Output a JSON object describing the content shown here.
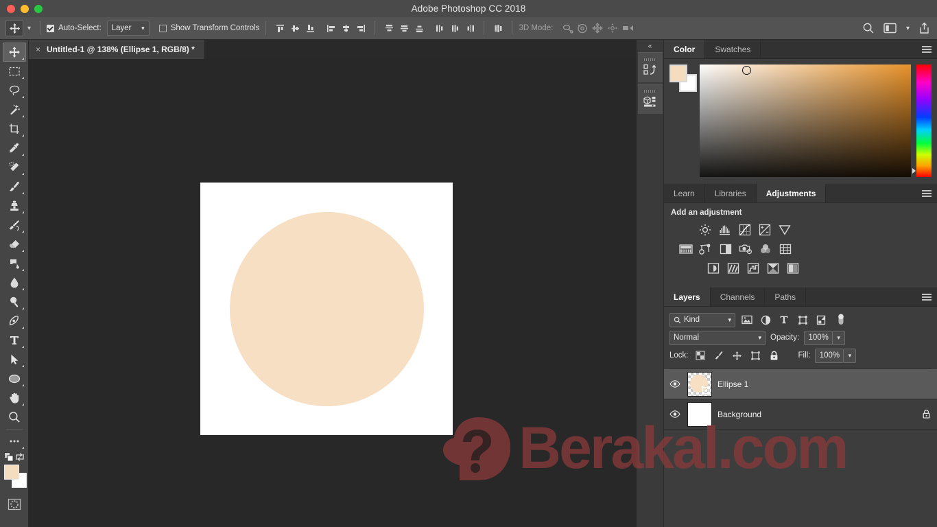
{
  "window": {
    "title": "Adobe Photoshop CC 2018",
    "traffic_lights": [
      {
        "name": "close",
        "color": "#ff5f57"
      },
      {
        "name": "minimize",
        "color": "#febc2e"
      },
      {
        "name": "maximize",
        "color": "#28c840"
      }
    ]
  },
  "options_bar": {
    "tool_icon": "move-tool-icon",
    "auto_select_checked": true,
    "auto_select_label": "Auto-Select:",
    "auto_select_value": "Layer",
    "show_transform_checked": false,
    "show_transform_label": "Show Transform Controls",
    "align_group_1": [
      "align-top-edges-icon",
      "align-vertical-centers-icon",
      "align-bottom-edges-icon"
    ],
    "align_group_2": [
      "align-left-edges-icon",
      "align-horizontal-centers-icon",
      "align-right-edges-icon"
    ],
    "distribute_group_1": [
      "distribute-top-edges-icon",
      "distribute-vertical-centers-icon",
      "distribute-bottom-edges-icon"
    ],
    "distribute_group_2": [
      "distribute-left-edges-icon",
      "distribute-horizontal-centers-icon",
      "distribute-right-edges-icon"
    ],
    "auto_align_icon": "auto-align-layers-icon",
    "mode_3d_label": "3D Mode:",
    "mode_3d_icons": [
      "rotate-3d-object-icon",
      "roll-3d-object-icon",
      "drag-3d-object-icon",
      "slide-3d-object-icon",
      "scale-3d-object-icon"
    ],
    "right_icons": [
      "search-icon",
      "workspace-switcher-icon",
      "chevron-down-icon",
      "share-icon"
    ]
  },
  "document_tab": {
    "close_glyph": "×",
    "title": "Untitled-1 @ 138% (Ellipse 1, RGB/8) *"
  },
  "toolbar": {
    "tools": [
      {
        "name": "move-tool",
        "active": true
      },
      {
        "name": "rectangular-marquee-tool",
        "active": false
      },
      {
        "name": "lasso-tool",
        "active": false
      },
      {
        "name": "magic-wand-tool",
        "active": false
      },
      {
        "name": "crop-tool",
        "active": false
      },
      {
        "name": "eyedropper-tool",
        "active": false
      },
      {
        "name": "spot-healing-brush-tool",
        "active": false
      },
      {
        "name": "brush-tool",
        "active": false
      },
      {
        "name": "clone-stamp-tool",
        "active": false
      },
      {
        "name": "history-brush-tool",
        "active": false
      },
      {
        "name": "eraser-tool",
        "active": false
      },
      {
        "name": "gradient-tool",
        "active": false
      },
      {
        "name": "blur-tool",
        "active": false
      },
      {
        "name": "dodge-tool",
        "active": false
      },
      {
        "name": "pen-tool",
        "active": false
      },
      {
        "name": "horizontal-type-tool",
        "active": false
      },
      {
        "name": "path-selection-tool",
        "active": false
      },
      {
        "name": "ellipse-tool",
        "active": false
      },
      {
        "name": "hand-tool",
        "active": false
      },
      {
        "name": "zoom-tool",
        "active": false
      },
      {
        "name": "edit-toolbar-tool",
        "active": false
      }
    ],
    "foreground_color": "#f4dcbe",
    "background_color": "#ffffff",
    "quick_mask_icon": "quick-mask-mode-icon"
  },
  "canvas": {
    "background_color": "#282828",
    "artboard_color": "#ffffff",
    "shape": {
      "type": "ellipse",
      "fill": "#f6dfc3"
    }
  },
  "icon_dock": {
    "collapse_glyph": "«",
    "buttons": [
      "history-panel-icon",
      "properties-panel-icon"
    ]
  },
  "color_panel": {
    "tabs": [
      {
        "label": "Color",
        "active": true
      },
      {
        "label": "Swatches",
        "active": false
      }
    ],
    "menu_icon": "panel-menu-icon",
    "foreground_color": "#f4dcbe",
    "background_color": "#ffffff",
    "ramp_start": "#ffffff",
    "ramp_end": "#e8922a"
  },
  "adjustments_panel": {
    "tabs": [
      {
        "label": "Learn",
        "active": false
      },
      {
        "label": "Libraries",
        "active": false
      },
      {
        "label": "Adjustments",
        "active": true
      }
    ],
    "menu_icon": "panel-menu-icon",
    "heading": "Add an adjustment",
    "rows": [
      [
        "brightness-contrast-icon",
        "levels-icon",
        "curves-icon",
        "exposure-icon",
        "vibrance-icon"
      ],
      [
        "hue-saturation-icon",
        "color-balance-icon",
        "black-white-icon",
        "photo-filter-icon",
        "channel-mixer-icon",
        "color-lookup-icon"
      ],
      [
        "invert-icon",
        "posterize-icon",
        "threshold-icon",
        "gradient-map-icon",
        "selective-color-icon"
      ]
    ]
  },
  "layers_panel": {
    "tabs": [
      {
        "label": "Layers",
        "active": true
      },
      {
        "label": "Channels",
        "active": false
      },
      {
        "label": "Paths",
        "active": false
      }
    ],
    "menu_icon": "panel-menu-icon",
    "filter_label": "Kind",
    "filter_icons": [
      "filter-pixel-layers-icon",
      "filter-adjustment-layers-icon",
      "filter-type-layers-icon",
      "filter-shape-layers-icon",
      "filter-smart-objects-icon"
    ],
    "filter_toggle_icon": "filter-enable-toggle",
    "blend_mode": "Normal",
    "opacity_label": "Opacity:",
    "opacity_value": "100%",
    "lock_label": "Lock:",
    "lock_icons": [
      "lock-transparent-pixels-icon",
      "lock-image-pixels-icon",
      "lock-position-icon",
      "lock-artboard-nesting-icon",
      "lock-all-icon"
    ],
    "fill_label": "Fill:",
    "fill_value": "100%",
    "layers": [
      {
        "name": "Ellipse 1",
        "visible": true,
        "selected": true,
        "thumbnail": "shape-thumbnail",
        "locked": false
      },
      {
        "name": "Background",
        "visible": true,
        "selected": false,
        "thumbnail": "white-thumbnail",
        "locked": true
      }
    ]
  },
  "watermark": {
    "text": "Berakal.com",
    "logo_icon": "question-head-logo-icon",
    "color": "#8e3a3a"
  }
}
